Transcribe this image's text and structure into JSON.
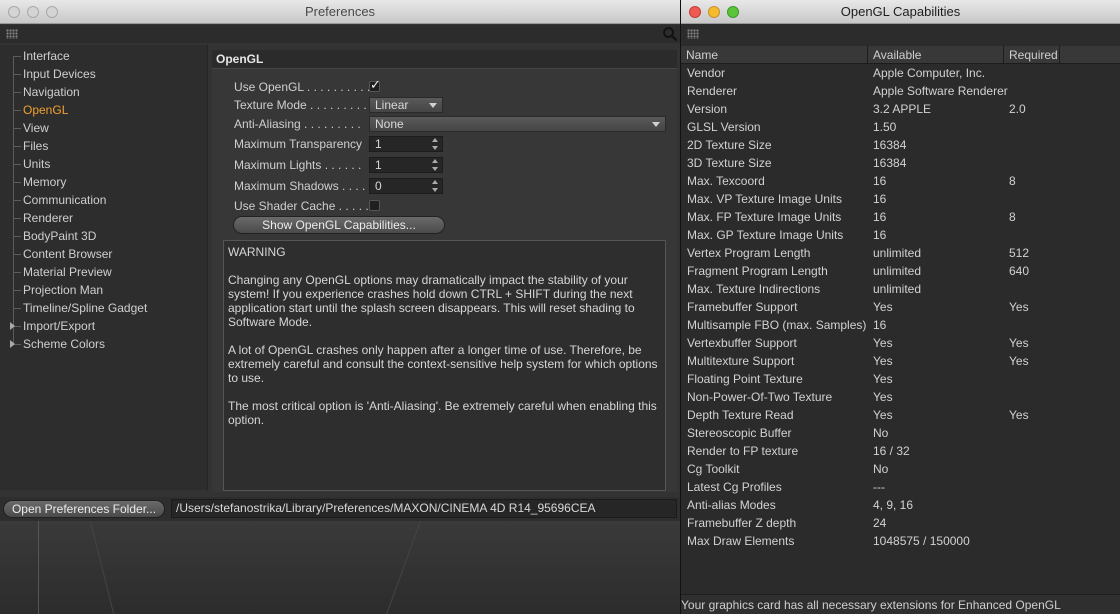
{
  "preferences": {
    "title": "Preferences",
    "sidebar": {
      "items": [
        {
          "label": "Interface"
        },
        {
          "label": "Input Devices"
        },
        {
          "label": "Navigation"
        },
        {
          "label": "OpenGL"
        },
        {
          "label": "View"
        },
        {
          "label": "Files"
        },
        {
          "label": "Units"
        },
        {
          "label": "Memory"
        },
        {
          "label": "Communication"
        },
        {
          "label": "Renderer"
        },
        {
          "label": "BodyPaint 3D"
        },
        {
          "label": "Content Browser"
        },
        {
          "label": "Material Preview"
        },
        {
          "label": "Projection Man"
        },
        {
          "label": "Timeline/Spline Gadget"
        },
        {
          "label": "Import/Export"
        },
        {
          "label": "Scheme Colors"
        }
      ],
      "active": "OpenGL"
    },
    "section_title": "OpenGL",
    "options": {
      "use_opengl": {
        "label": "Use OpenGL . . . . . . . . . .",
        "checked": true
      },
      "texture_mode": {
        "label": "Texture Mode . . . . . . . . .",
        "value": "Linear"
      },
      "anti_aliasing": {
        "label": "Anti-Aliasing . . . . . . . . .",
        "value": "None"
      },
      "max_transparency": {
        "label": "Maximum Transparency",
        "value": "1"
      },
      "max_lights": {
        "label": "Maximum Lights . . . . . .",
        "value": "1"
      },
      "max_shadows": {
        "label": "Maximum Shadows . . . .",
        "value": "0"
      },
      "use_shader_cache": {
        "label": "Use Shader Cache . . . . .",
        "checked": false
      }
    },
    "show_caps_button": "Show OpenGL Capabilities...",
    "warning": {
      "title": "WARNING",
      "p1": "Changing any OpenGL options may dramatically impact the stability of your system! If you experience crashes hold down CTRL + SHIFT during the next application start until the splash screen disappears. This will reset shading to Software Mode.",
      "p2": "A lot of OpenGL crashes only happen after a longer time of use. Therefore, be extremely careful and consult the context-sensitive help system for which options to use.",
      "p3": "The most critical option is 'Anti-Aliasing'. Be extremely careful when enabling this option."
    },
    "open_folder_button": "Open Preferences Folder...",
    "path": "/Users/stefanostrika/Library/Preferences/MAXON/CINEMA 4D R14_95696CEA"
  },
  "capabilities": {
    "title": "OpenGL Capabilities",
    "columns": [
      "Name",
      "Available",
      "Required"
    ],
    "rows": [
      [
        "Vendor",
        "Apple Computer, Inc.",
        ""
      ],
      [
        "Renderer",
        "Apple Software Renderer",
        ""
      ],
      [
        "Version",
        "3.2 APPLE",
        "2.0"
      ],
      [
        "GLSL Version",
        "1.50",
        ""
      ],
      [
        "2D Texture Size",
        "16384",
        ""
      ],
      [
        "3D Texture Size",
        "16384",
        ""
      ],
      [
        "Max. Texcoord",
        "16",
        "8"
      ],
      [
        "Max. VP Texture Image Units",
        "16",
        ""
      ],
      [
        "Max. FP Texture Image Units",
        "16",
        "8"
      ],
      [
        "Max. GP Texture Image Units",
        "16",
        ""
      ],
      [
        "Vertex Program Length",
        "unlimited",
        "512"
      ],
      [
        "Fragment Program Length",
        "unlimited",
        "640"
      ],
      [
        "Max. Texture Indirections",
        "unlimited",
        ""
      ],
      [
        "Framebuffer Support",
        "Yes",
        "Yes"
      ],
      [
        "Multisample FBO (max. Samples)",
        "16",
        ""
      ],
      [
        "Vertexbuffer Support",
        "Yes",
        "Yes"
      ],
      [
        "Multitexture Support",
        "Yes",
        "Yes"
      ],
      [
        "Floating Point Texture",
        "Yes",
        ""
      ],
      [
        "Non-Power-Of-Two Texture",
        "Yes",
        ""
      ],
      [
        "Depth Texture Read",
        "Yes",
        "Yes"
      ],
      [
        "Stereoscopic Buffer",
        "No",
        ""
      ],
      [
        "Render to FP texture",
        "16 / 32",
        ""
      ],
      [
        "Cg Toolkit",
        "No",
        ""
      ],
      [
        "Latest Cg Profiles",
        "---",
        ""
      ],
      [
        "Anti-alias Modes",
        "4, 9, 16",
        ""
      ],
      [
        "Framebuffer Z depth",
        "24",
        ""
      ],
      [
        "Max Draw Elements",
        "1048575 / 150000",
        ""
      ]
    ],
    "status": "Your graphics card has all necessary extensions for Enhanced OpenGL"
  },
  "colors": {
    "active_item": "#f0a030",
    "close_button": "#ee5a52",
    "minimize_button": "#f4bb2d",
    "zoom_button": "#5bc43a"
  }
}
